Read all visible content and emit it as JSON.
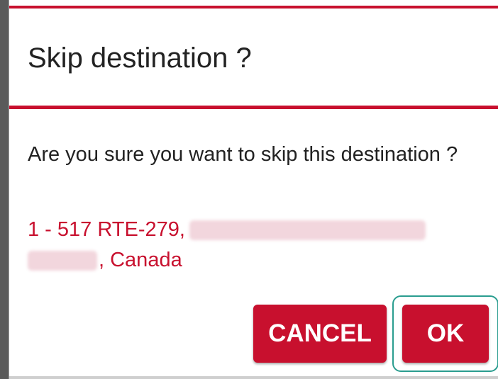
{
  "dialog": {
    "title": "Skip destination ?",
    "message": "Are you sure you want to skip this destination ?",
    "address": {
      "line_prefix": "1 - 517 RTE-279,",
      "line_suffix": ", Canada"
    },
    "buttons": {
      "cancel_label": "CANCEL",
      "ok_label": "OK"
    }
  },
  "colors": {
    "accent": "#c8102e",
    "focus_ring": "#2a9d8f",
    "title_text": "#222222"
  }
}
